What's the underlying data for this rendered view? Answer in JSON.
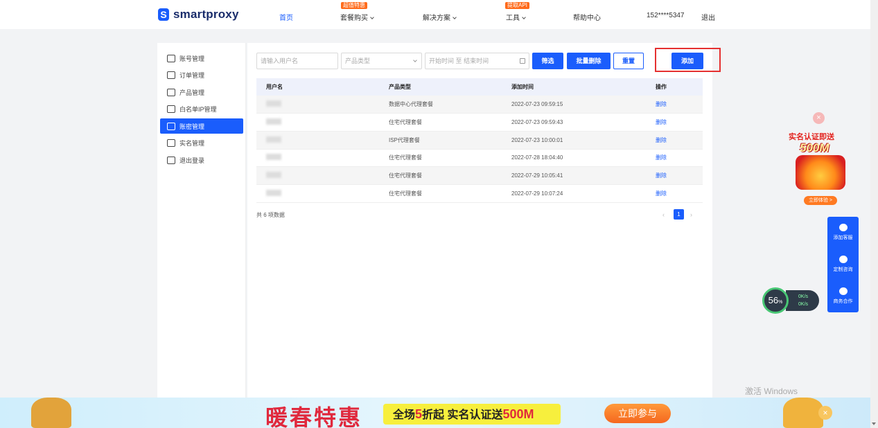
{
  "nav": {
    "logo_mark": "S",
    "logo_text": "smartproxy",
    "items": [
      {
        "label": "首页",
        "active": true
      },
      {
        "label": "套餐购买",
        "badge": "超值特惠",
        "dropdown": true
      },
      {
        "label": "解决方案",
        "dropdown": true
      },
      {
        "label": "工具",
        "badge": "提取API",
        "dropdown": true
      },
      {
        "label": "帮助中心"
      }
    ],
    "user": "152****5347",
    "logout": "退出"
  },
  "sidebar": {
    "items": [
      {
        "label": "账号管理",
        "icon": "user-icon"
      },
      {
        "label": "订单管理",
        "icon": "order-icon"
      },
      {
        "label": "产品管理",
        "icon": "cart-icon"
      },
      {
        "label": "白名单IP管理",
        "icon": "document-icon"
      },
      {
        "label": "账密管理",
        "icon": "user-key-icon",
        "active": true
      },
      {
        "label": "实名管理",
        "icon": "shield-icon"
      },
      {
        "label": "退出登录",
        "icon": "logout-icon"
      }
    ]
  },
  "filters": {
    "username_placeholder": "请输入用户名",
    "product_type_placeholder": "产品类型",
    "date_start_placeholder": "开始时间",
    "date_sep": "至",
    "date_end_placeholder": "结束时间",
    "filter_btn": "筛选",
    "batch_delete_btn": "批量删除",
    "reset_btn": "重置",
    "add_btn": "添加"
  },
  "table": {
    "headers": [
      "用户名",
      "产品类型",
      "添加时间",
      "操作"
    ],
    "rows": [
      {
        "username": "",
        "product": "数据中心代理套餐",
        "time": "2022-07-23 09:59:15",
        "action": "删除"
      },
      {
        "username": "",
        "product": "住宅代理套餐",
        "time": "2022-07-23 09:59:43",
        "action": "删除"
      },
      {
        "username": "",
        "product": "ISP代理套餐",
        "time": "2022-07-23 10:00:01",
        "action": "删除"
      },
      {
        "username": "",
        "product": "住宅代理套餐",
        "time": "2022-07-28 18:04:40",
        "action": "删除"
      },
      {
        "username": "",
        "product": "住宅代理套餐",
        "time": "2022-07-29 10:05:41",
        "action": "删除"
      },
      {
        "username": "",
        "product": "住宅代理套餐",
        "time": "2022-07-29 10:07:24",
        "action": "删除"
      }
    ],
    "total_text": "共 6 项数据",
    "current_page": "1"
  },
  "promo_float": {
    "close": "×",
    "title": "实名认证即送",
    "amount": "500M",
    "button": "立即体验 >"
  },
  "service": {
    "items": [
      "添加客服",
      "定制咨询",
      "商务合作"
    ]
  },
  "speed": {
    "percent": "56",
    "percent_unit": "%",
    "up": "0",
    "down": "0",
    "unit": "K/s"
  },
  "watermark": "激活 Windows",
  "banner": {
    "title": "暖春特惠",
    "pill_prefix": "全场",
    "pill_num": "5",
    "pill_mid": "折起  实名认证送",
    "pill_amount": "500M",
    "button": "立即参与",
    "close": "×"
  },
  "colors": {
    "brand": "#1a5dfc",
    "highlight": "#e53030",
    "badge": "#ff6a1a"
  }
}
